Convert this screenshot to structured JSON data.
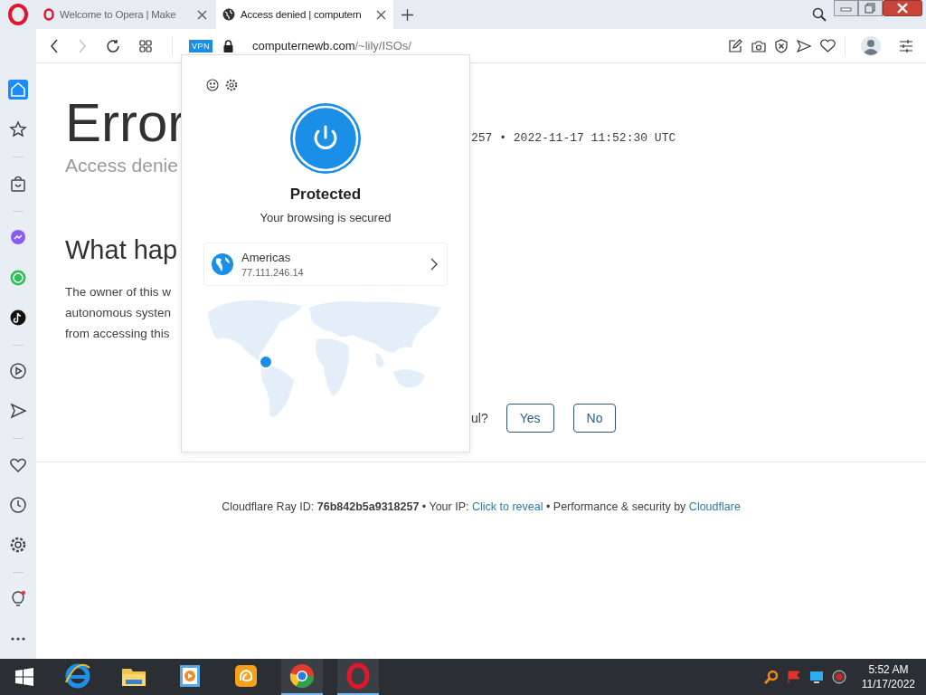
{
  "browser": {
    "tabs": [
      {
        "title": "Welcome to Opera | Make",
        "selected": false
      },
      {
        "title": "Access denied | computern",
        "selected": true
      }
    ]
  },
  "address_bar": {
    "vpn_badge": "VPN",
    "url_host": "computernewb.com",
    "url_path": "/~lily/ISOs/",
    "forward_disabled": true
  },
  "sidebar": {
    "groups": [
      [
        {
          "selected": true
        },
        {
          "selected": false
        }
      ],
      [
        {
          "selected": false
        }
      ],
      [
        {
          "selected": false
        },
        {
          "selected": false
        },
        {
          "selected": false
        }
      ],
      [
        {
          "selected": false
        },
        {
          "selected": false
        }
      ],
      [
        {
          "selected": false
        },
        {
          "selected": false
        },
        {
          "selected": false
        }
      ],
      [
        {
          "selected": false
        },
        {
          "selected": false
        }
      ]
    ]
  },
  "page": {
    "heading": "Error",
    "subheading": "Access denie",
    "ray_info": "257 • 2022-11-17 11:52:30 UTC",
    "section_heading": "What hap",
    "paragraph_lines": [
      "The owner of this w",
      "autonomous systen",
      "from accessing this"
    ],
    "question": "ul?",
    "buttons": [
      "Yes",
      "No"
    ]
  },
  "footer": {
    "text": "Cloudflare Ray ID: **76b842b5a9318257** • Your IP: ",
    "ip_link": "Click to reveal",
    "text_2": " • Performance & security by ",
    "brand_link": "Cloudflare"
  },
  "vpn_popup": {
    "connected": true,
    "status": "Protected",
    "message": "Your browsing is secured",
    "location": {
      "name": "Americas",
      "ip": "77.111.246.14"
    }
  },
  "taskbar": {
    "apps": [
      {
        "open": false
      },
      {
        "open": false
      },
      {
        "open": false
      },
      {
        "open": false
      },
      {
        "open": true
      },
      {
        "open": true
      }
    ],
    "clock": {
      "time": "5:52 AM",
      "date": "11/17/2022"
    }
  }
}
